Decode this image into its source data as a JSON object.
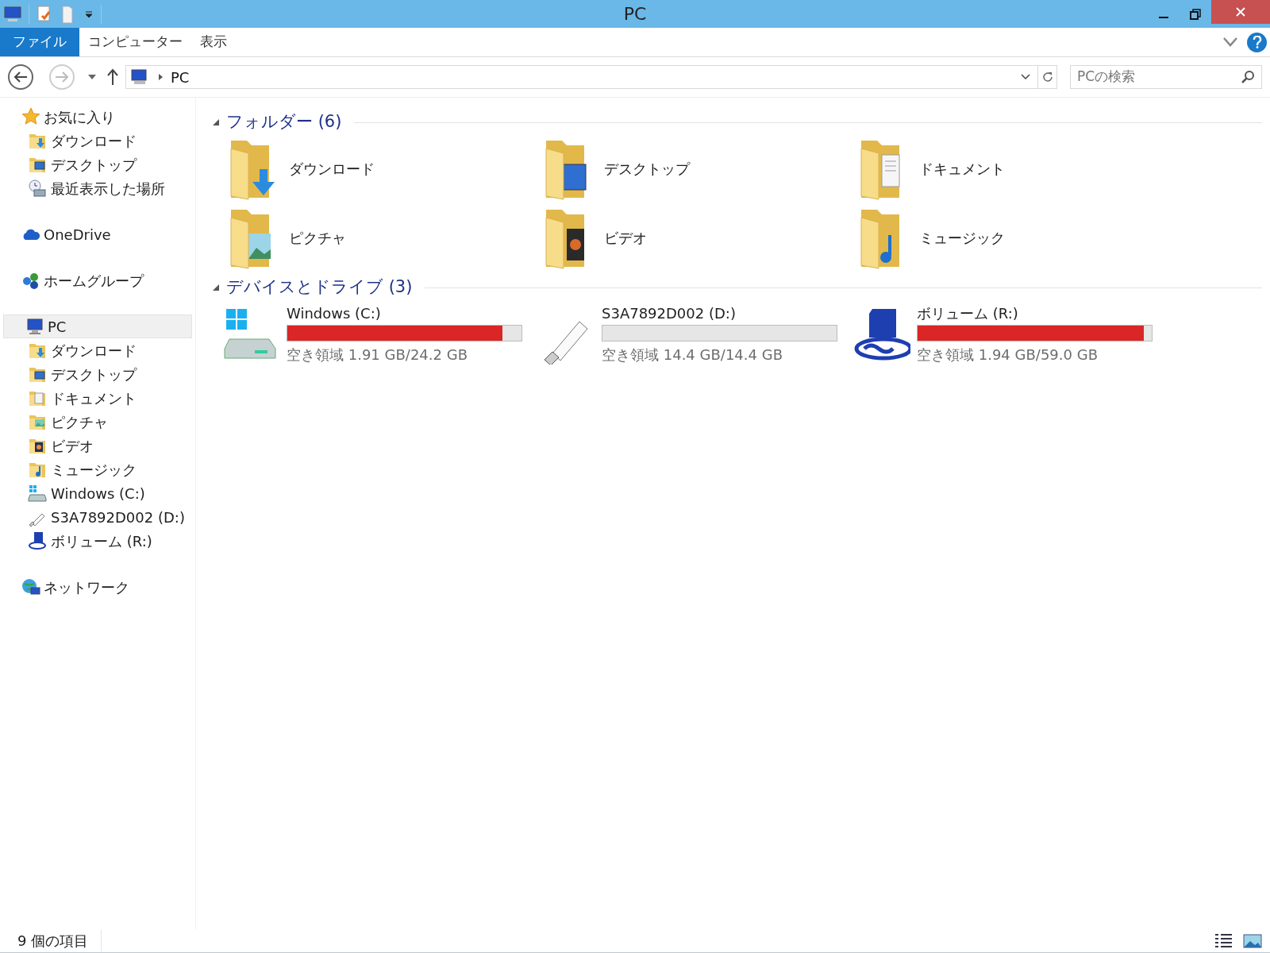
{
  "window": {
    "title": "PC"
  },
  "ribbon_tabs": [
    {
      "label": "ファイル",
      "selected": true
    },
    {
      "label": "コンピューター",
      "selected": false
    },
    {
      "label": "表示",
      "selected": false
    }
  ],
  "address": {
    "path": "PC"
  },
  "search": {
    "placeholder": "PCの検索"
  },
  "sidebar": {
    "items": [
      {
        "label": "お気に入り",
        "kind": "favorites",
        "selected": false,
        "children": [
          {
            "label": "ダウンロード",
            "kind": "downloads",
            "selected": false
          },
          {
            "label": "デスクトップ",
            "kind": "desktop",
            "selected": false
          },
          {
            "label": "最近表示した場所",
            "kind": "recent",
            "selected": false
          }
        ]
      },
      {
        "label": "OneDrive",
        "kind": "cloud",
        "selected": false
      },
      {
        "label": "ホームグループ",
        "kind": "homegroup",
        "selected": false
      },
      {
        "label": "PC",
        "kind": "pc",
        "selected": true,
        "children": [
          {
            "label": "ダウンロード",
            "kind": "downloads",
            "selected": false
          },
          {
            "label": "デスクトップ",
            "kind": "desktop",
            "selected": false
          },
          {
            "label": "ドキュメント",
            "kind": "documents",
            "selected": false
          },
          {
            "label": "ピクチャ",
            "kind": "pictures",
            "selected": false
          },
          {
            "label": "ビデオ",
            "kind": "videos",
            "selected": false
          },
          {
            "label": "ミュージック",
            "kind": "music",
            "selected": false
          },
          {
            "label": "Windows (C:)",
            "kind": "hdd",
            "selected": false
          },
          {
            "label": "S3A7892D002 (D:)",
            "kind": "usb",
            "selected": false
          },
          {
            "label": "ボリューム (R:)",
            "kind": "sd",
            "selected": false
          }
        ]
      },
      {
        "label": "ネットワーク",
        "kind": "network",
        "selected": false
      }
    ]
  },
  "folders": {
    "heading": "フォルダー (6)",
    "items": [
      {
        "label": "ダウンロード",
        "kind": "downloads"
      },
      {
        "label": "デスクトップ",
        "kind": "desktop"
      },
      {
        "label": "ドキュメント",
        "kind": "documents"
      },
      {
        "label": "ピクチャ",
        "kind": "pictures"
      },
      {
        "label": "ビデオ",
        "kind": "videos"
      },
      {
        "label": "ミュージック",
        "kind": "music"
      }
    ]
  },
  "drives": {
    "heading": "デバイスとドライブ (3)",
    "items": [
      {
        "name": "Windows (C:)",
        "kind": "hdd",
        "level": 0.92,
        "free": "空き領域 1.91 GB/24.2 GB"
      },
      {
        "name": "S3A7892D002 (D:)",
        "kind": "usb",
        "level": 0,
        "free": "空き領域 14.4 GB/14.4 GB"
      },
      {
        "name": "ボリューム (R:)",
        "kind": "sd",
        "level": 0.967,
        "free": "空き領域 1.94 GB/59.0 GB"
      }
    ]
  },
  "status_bar": {
    "count": "9 個の項目"
  }
}
